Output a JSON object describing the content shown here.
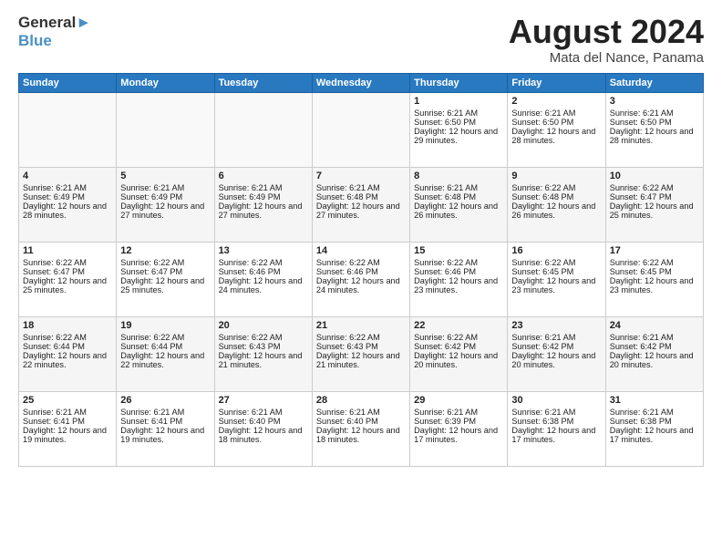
{
  "logo": {
    "line1": "General",
    "line2": "Blue"
  },
  "title": "August 2024",
  "location": "Mata del Nance, Panama",
  "days_of_week": [
    "Sunday",
    "Monday",
    "Tuesday",
    "Wednesday",
    "Thursday",
    "Friday",
    "Saturday"
  ],
  "weeks": [
    [
      {
        "day": "",
        "sunrise": "",
        "sunset": "",
        "daylight": ""
      },
      {
        "day": "",
        "sunrise": "",
        "sunset": "",
        "daylight": ""
      },
      {
        "day": "",
        "sunrise": "",
        "sunset": "",
        "daylight": ""
      },
      {
        "day": "",
        "sunrise": "",
        "sunset": "",
        "daylight": ""
      },
      {
        "day": "1",
        "sunrise": "Sunrise: 6:21 AM",
        "sunset": "Sunset: 6:50 PM",
        "daylight": "Daylight: 12 hours and 29 minutes."
      },
      {
        "day": "2",
        "sunrise": "Sunrise: 6:21 AM",
        "sunset": "Sunset: 6:50 PM",
        "daylight": "Daylight: 12 hours and 28 minutes."
      },
      {
        "day": "3",
        "sunrise": "Sunrise: 6:21 AM",
        "sunset": "Sunset: 6:50 PM",
        "daylight": "Daylight: 12 hours and 28 minutes."
      }
    ],
    [
      {
        "day": "4",
        "sunrise": "Sunrise: 6:21 AM",
        "sunset": "Sunset: 6:49 PM",
        "daylight": "Daylight: 12 hours and 28 minutes."
      },
      {
        "day": "5",
        "sunrise": "Sunrise: 6:21 AM",
        "sunset": "Sunset: 6:49 PM",
        "daylight": "Daylight: 12 hours and 27 minutes."
      },
      {
        "day": "6",
        "sunrise": "Sunrise: 6:21 AM",
        "sunset": "Sunset: 6:49 PM",
        "daylight": "Daylight: 12 hours and 27 minutes."
      },
      {
        "day": "7",
        "sunrise": "Sunrise: 6:21 AM",
        "sunset": "Sunset: 6:48 PM",
        "daylight": "Daylight: 12 hours and 27 minutes."
      },
      {
        "day": "8",
        "sunrise": "Sunrise: 6:21 AM",
        "sunset": "Sunset: 6:48 PM",
        "daylight": "Daylight: 12 hours and 26 minutes."
      },
      {
        "day": "9",
        "sunrise": "Sunrise: 6:22 AM",
        "sunset": "Sunset: 6:48 PM",
        "daylight": "Daylight: 12 hours and 26 minutes."
      },
      {
        "day": "10",
        "sunrise": "Sunrise: 6:22 AM",
        "sunset": "Sunset: 6:47 PM",
        "daylight": "Daylight: 12 hours and 25 minutes."
      }
    ],
    [
      {
        "day": "11",
        "sunrise": "Sunrise: 6:22 AM",
        "sunset": "Sunset: 6:47 PM",
        "daylight": "Daylight: 12 hours and 25 minutes."
      },
      {
        "day": "12",
        "sunrise": "Sunrise: 6:22 AM",
        "sunset": "Sunset: 6:47 PM",
        "daylight": "Daylight: 12 hours and 25 minutes."
      },
      {
        "day": "13",
        "sunrise": "Sunrise: 6:22 AM",
        "sunset": "Sunset: 6:46 PM",
        "daylight": "Daylight: 12 hours and 24 minutes."
      },
      {
        "day": "14",
        "sunrise": "Sunrise: 6:22 AM",
        "sunset": "Sunset: 6:46 PM",
        "daylight": "Daylight: 12 hours and 24 minutes."
      },
      {
        "day": "15",
        "sunrise": "Sunrise: 6:22 AM",
        "sunset": "Sunset: 6:46 PM",
        "daylight": "Daylight: 12 hours and 23 minutes."
      },
      {
        "day": "16",
        "sunrise": "Sunrise: 6:22 AM",
        "sunset": "Sunset: 6:45 PM",
        "daylight": "Daylight: 12 hours and 23 minutes."
      },
      {
        "day": "17",
        "sunrise": "Sunrise: 6:22 AM",
        "sunset": "Sunset: 6:45 PM",
        "daylight": "Daylight: 12 hours and 23 minutes."
      }
    ],
    [
      {
        "day": "18",
        "sunrise": "Sunrise: 6:22 AM",
        "sunset": "Sunset: 6:44 PM",
        "daylight": "Daylight: 12 hours and 22 minutes."
      },
      {
        "day": "19",
        "sunrise": "Sunrise: 6:22 AM",
        "sunset": "Sunset: 6:44 PM",
        "daylight": "Daylight: 12 hours and 22 minutes."
      },
      {
        "day": "20",
        "sunrise": "Sunrise: 6:22 AM",
        "sunset": "Sunset: 6:43 PM",
        "daylight": "Daylight: 12 hours and 21 minutes."
      },
      {
        "day": "21",
        "sunrise": "Sunrise: 6:22 AM",
        "sunset": "Sunset: 6:43 PM",
        "daylight": "Daylight: 12 hours and 21 minutes."
      },
      {
        "day": "22",
        "sunrise": "Sunrise: 6:22 AM",
        "sunset": "Sunset: 6:42 PM",
        "daylight": "Daylight: 12 hours and 20 minutes."
      },
      {
        "day": "23",
        "sunrise": "Sunrise: 6:21 AM",
        "sunset": "Sunset: 6:42 PM",
        "daylight": "Daylight: 12 hours and 20 minutes."
      },
      {
        "day": "24",
        "sunrise": "Sunrise: 6:21 AM",
        "sunset": "Sunset: 6:42 PM",
        "daylight": "Daylight: 12 hours and 20 minutes."
      }
    ],
    [
      {
        "day": "25",
        "sunrise": "Sunrise: 6:21 AM",
        "sunset": "Sunset: 6:41 PM",
        "daylight": "Daylight: 12 hours and 19 minutes."
      },
      {
        "day": "26",
        "sunrise": "Sunrise: 6:21 AM",
        "sunset": "Sunset: 6:41 PM",
        "daylight": "Daylight: 12 hours and 19 minutes."
      },
      {
        "day": "27",
        "sunrise": "Sunrise: 6:21 AM",
        "sunset": "Sunset: 6:40 PM",
        "daylight": "Daylight: 12 hours and 18 minutes."
      },
      {
        "day": "28",
        "sunrise": "Sunrise: 6:21 AM",
        "sunset": "Sunset: 6:40 PM",
        "daylight": "Daylight: 12 hours and 18 minutes."
      },
      {
        "day": "29",
        "sunrise": "Sunrise: 6:21 AM",
        "sunset": "Sunset: 6:39 PM",
        "daylight": "Daylight: 12 hours and 17 minutes."
      },
      {
        "day": "30",
        "sunrise": "Sunrise: 6:21 AM",
        "sunset": "Sunset: 6:38 PM",
        "daylight": "Daylight: 12 hours and 17 minutes."
      },
      {
        "day": "31",
        "sunrise": "Sunrise: 6:21 AM",
        "sunset": "Sunset: 6:38 PM",
        "daylight": "Daylight: 12 hours and 17 minutes."
      }
    ]
  ]
}
